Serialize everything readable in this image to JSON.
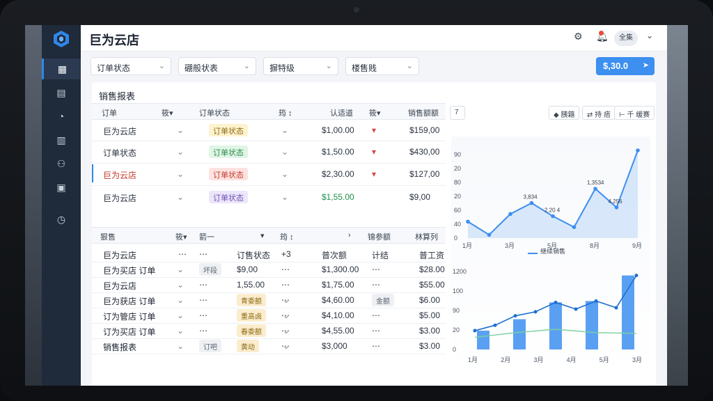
{
  "app": {
    "title": "巨为云店"
  },
  "top_right": {
    "user_label": "全集",
    "icons": [
      "user-settings-icon",
      "bell-icon",
      "chevron-down-icon"
    ]
  },
  "filters": [
    {
      "label": "订单状态"
    },
    {
      "label": "硼般状表"
    },
    {
      "label": "摒特级"
    },
    {
      "label": "楼售贱"
    }
  ],
  "price_button": {
    "label": "$,30.0"
  },
  "sales_section": {
    "title": "销售报表"
  },
  "table1": {
    "headers": [
      "订单",
      "筱▾",
      "订单状态",
      "筠 ↕",
      "认适道",
      "筱▾",
      "销售额额"
    ],
    "rows": [
      {
        "name": "巨为云店",
        "status": "订单状态",
        "amount": "$1,00.00",
        "mark": "▾",
        "sales": "$159,00"
      },
      {
        "name": "订单状态",
        "status": "订单状态",
        "amount": "$1,50.00",
        "mark": "▾",
        "sales": "$430,00"
      },
      {
        "name": "巨为云店",
        "status": "订单状态",
        "amount": "$2,30.00",
        "mark": "▾",
        "sales": "$127,00"
      },
      {
        "name": "巨为云店",
        "status": "订单状态",
        "amount": "$1,55.00",
        "mark": "",
        "sales": "$9,00"
      }
    ]
  },
  "table2": {
    "headers": [
      "狠售",
      "筱▾",
      "箭一",
      "▾",
      "筠 ↕",
      "›",
      "锦参额",
      "林算列"
    ],
    "rows": [
      {
        "name": "巨为云店",
        "c2": "⋯",
        "c3": "⋯",
        "c4": "订售状态",
        "c5": "+3",
        "c6": "普次额",
        "c7": "计结",
        "c8": "普工资"
      },
      {
        "name": "巨为买店 订单",
        "c2": "",
        "c3": "坏段",
        "c4": "$9,00",
        "c5": "⋯",
        "c6": "$1,300.00",
        "c7": "⋯",
        "c8": "$28.00"
      },
      {
        "name": "巨为云店",
        "c2": "",
        "c3": "⋯",
        "c4": "1,55.00",
        "c5": "⋯",
        "c6": "$1,75.00",
        "c7": "⋯",
        "c8": "$55.00"
      },
      {
        "name": "巨为获店 订单",
        "c2": "",
        "c3": "⋯",
        "c4": "青委额",
        "c5": "⋯",
        "c6": "$4,60.00",
        "c7": "金额",
        "c8": "$6.00"
      },
      {
        "name": "订为管店 订单",
        "c2": "",
        "c3": "⋯",
        "c4": "重高卤",
        "c5": "⋯",
        "c6": "$4,10.00",
        "c7": "⋯",
        "c8": "$5.00"
      },
      {
        "name": "订为买店 订单",
        "c2": "",
        "c3": "⋯",
        "c4": "春委额",
        "c5": "⋯",
        "c6": "$4,55.00",
        "c7": "⋯",
        "c8": "$3.00"
      },
      {
        "name": "销售报表",
        "c2": "",
        "c3": "订吧",
        "c4": "黄动",
        "c5": "⋯",
        "c6": "$3,000",
        "c7": "⋯",
        "c8": "$3.00"
      }
    ]
  },
  "chart_toolbar": {
    "buttons": [
      "7",
      "◆ 胰籍",
      "⇄ 持 痞",
      "⊢ 千 缓赛"
    ]
  },
  "chart_data": [
    {
      "type": "line",
      "x": [
        "1月",
        "3月",
        "5月",
        "8月",
        "9月"
      ],
      "y_ticks": [
        "0",
        "40",
        "60",
        "20",
        "80",
        "20",
        "90"
      ],
      "series": [
        {
          "name": "继续销售",
          "values": [
            15,
            3,
            22,
            32,
            20,
            10,
            45,
            28,
            80
          ]
        }
      ],
      "annotations": [
        "3,834",
        "2.20 4",
        "1,3534",
        "4.256"
      ],
      "title": ""
    },
    {
      "type": "bar",
      "x": [
        "1月",
        "2月",
        "3月",
        "4月",
        "5月",
        "3月"
      ],
      "y_ticks": [
        "0",
        "20",
        "90",
        "100",
        "1200"
      ],
      "series": [
        {
          "values": [
            28,
            45,
            70,
            72,
            110
          ]
        },
        {
          "values": [
            18,
            25,
            30,
            25,
            24
          ]
        }
      ],
      "title": ""
    }
  ]
}
